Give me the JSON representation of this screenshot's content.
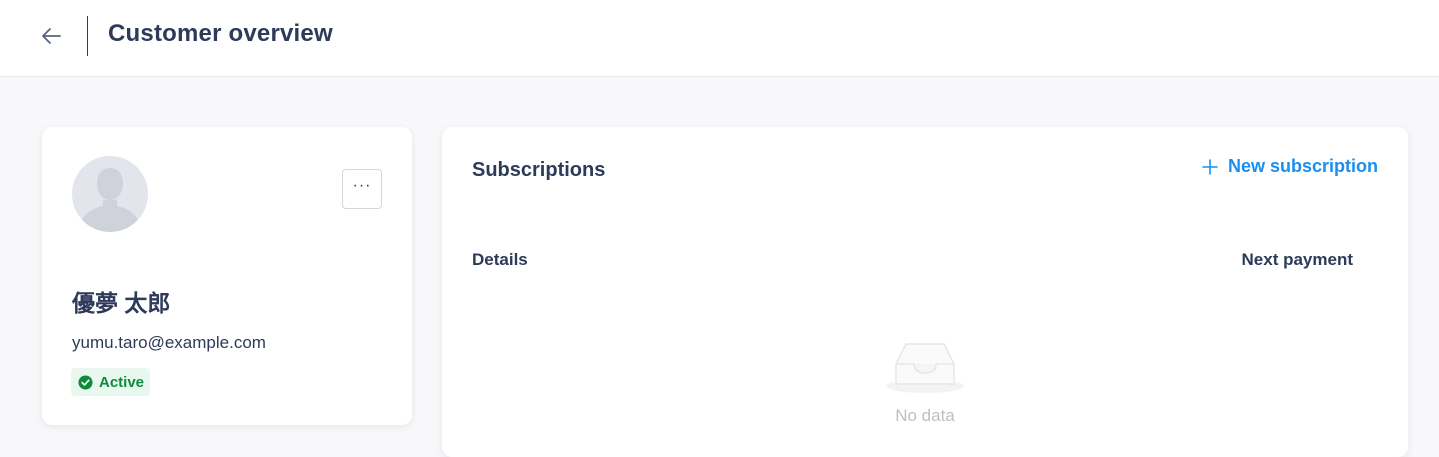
{
  "header": {
    "back_icon": "arrow-left-icon",
    "title": "Customer overview"
  },
  "customer": {
    "avatar_icon": "user-silhouette-icon",
    "more_label": "···",
    "name": "優夢 太郎",
    "email": "yumu.taro@example.com",
    "status": "Active",
    "status_icon": "check-circle-icon",
    "status_color": "#0f8a3c"
  },
  "subscriptions": {
    "title": "Subscriptions",
    "new_button_label": "New subscription",
    "new_button_icon": "plus-icon",
    "accent_color": "#1a8ff0",
    "columns": [
      "Details",
      "Next payment"
    ],
    "rows": [],
    "empty_icon": "empty-inbox-icon",
    "empty_text": "No data"
  }
}
